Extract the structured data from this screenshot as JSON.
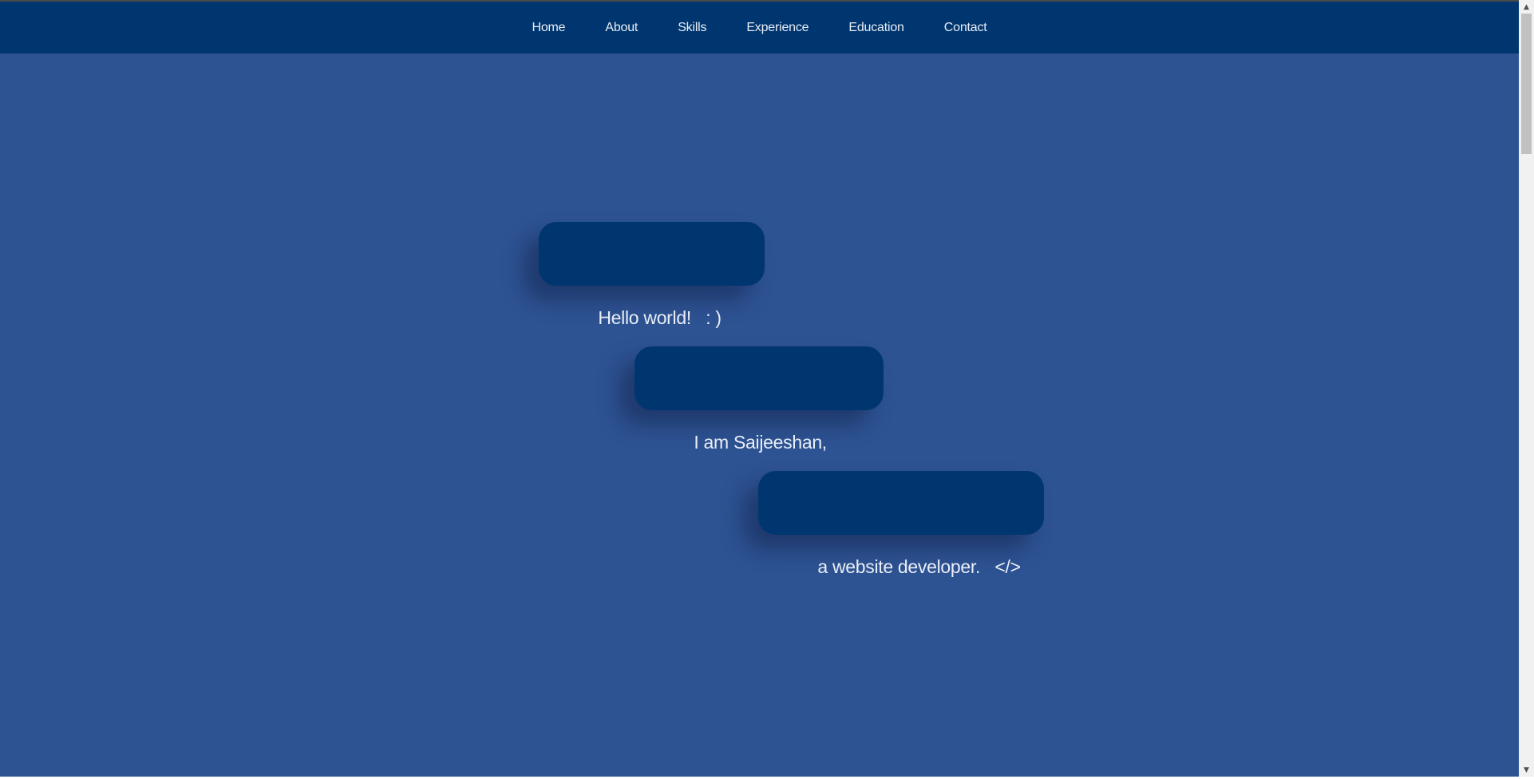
{
  "nav": {
    "items": [
      {
        "label": "Home"
      },
      {
        "label": "About"
      },
      {
        "label": "Skills"
      },
      {
        "label": "Experience"
      },
      {
        "label": "Education"
      },
      {
        "label": "Contact"
      }
    ]
  },
  "hero": {
    "line1": "Hello world!   : )",
    "line2": "I am Saijeeshan,",
    "line3": "a website developer.   </>"
  },
  "colors": {
    "page_background": "#2e5393",
    "navbar_background": "#00366f",
    "bubble_background": "#00366f",
    "text": "#e9eef7"
  },
  "icons": {
    "scroll_up": "scroll-up-arrow-icon",
    "scroll_down": "scroll-down-arrow-icon"
  }
}
